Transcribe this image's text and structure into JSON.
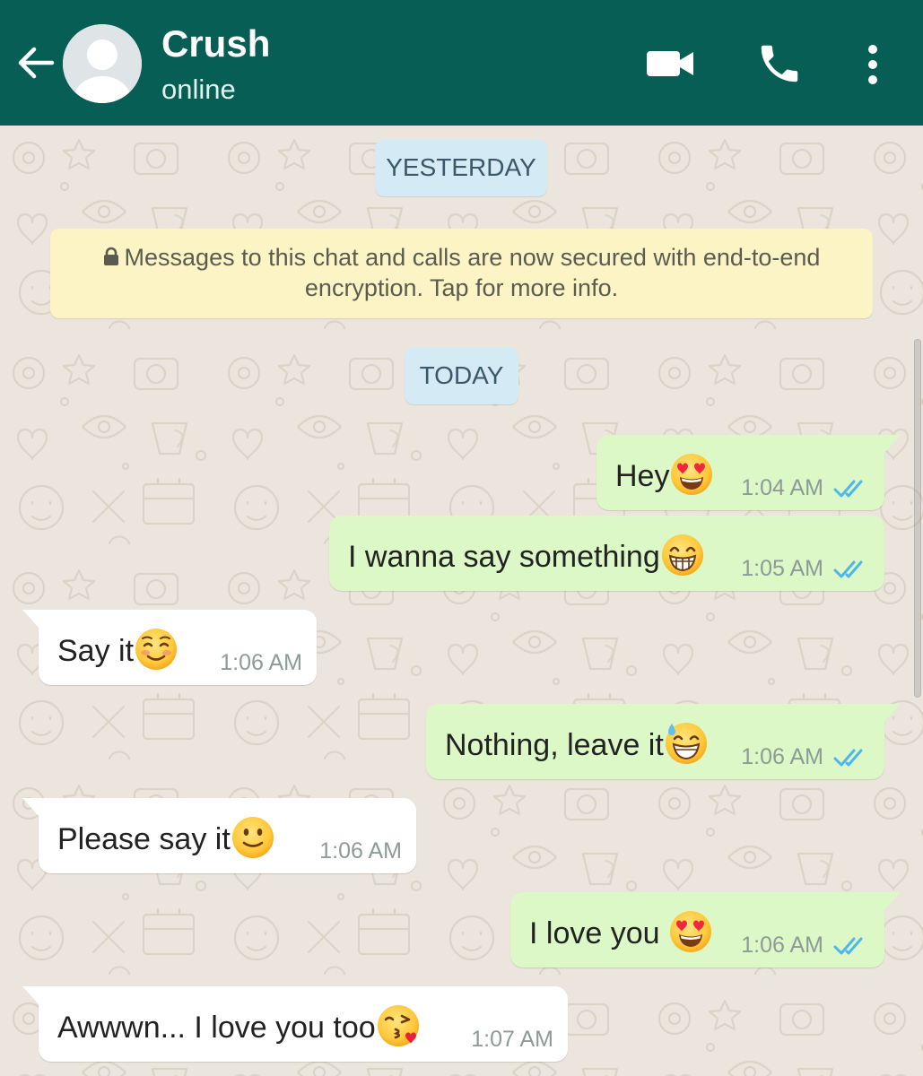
{
  "header": {
    "contact_name": "Crush",
    "status": "online",
    "back_icon": "arrow-left-icon",
    "video_icon": "video-camera-icon",
    "call_icon": "phone-icon",
    "menu_icon": "more-vert-icon",
    "bg_color": "#075e54"
  },
  "chat": {
    "date_yesterday": "YESTERDAY",
    "date_today": "TODAY",
    "encryption_line1": "Messages to this chat and calls are now secured with end-to-end",
    "encryption_line2": "encryption. Tap for more info.",
    "messages": [
      {
        "direction": "outgoing",
        "text": "Hey",
        "emoji": "heart-eyes",
        "time": "1:04 AM",
        "read": true
      },
      {
        "direction": "outgoing",
        "text": "I wanna say something",
        "emoji": "grinning",
        "time": "1:05 AM",
        "read": true
      },
      {
        "direction": "incoming",
        "text": "Say it",
        "emoji": "blushing",
        "time": "1:06 AM"
      },
      {
        "direction": "outgoing",
        "text": "Nothing, leave it",
        "emoji": "grinning-sweat",
        "time": "1:06 AM",
        "read": true
      },
      {
        "direction": "incoming",
        "text": "Please say it",
        "emoji": "slightly-smiling",
        "time": "1:06 AM"
      },
      {
        "direction": "outgoing",
        "text": "I love you",
        "emoji": "heart-eyes",
        "time": "1:06 AM",
        "read": true
      },
      {
        "direction": "incoming",
        "text": "Awwwn... I love you too",
        "emoji": "kissing-heart",
        "time": "1:07 AM"
      }
    ]
  },
  "colors": {
    "outgoing_bubble": "#dcf8c6",
    "incoming_bubble": "#ffffff",
    "read_ticks": "#4fb6ec",
    "chat_background": "#ece5dd"
  }
}
